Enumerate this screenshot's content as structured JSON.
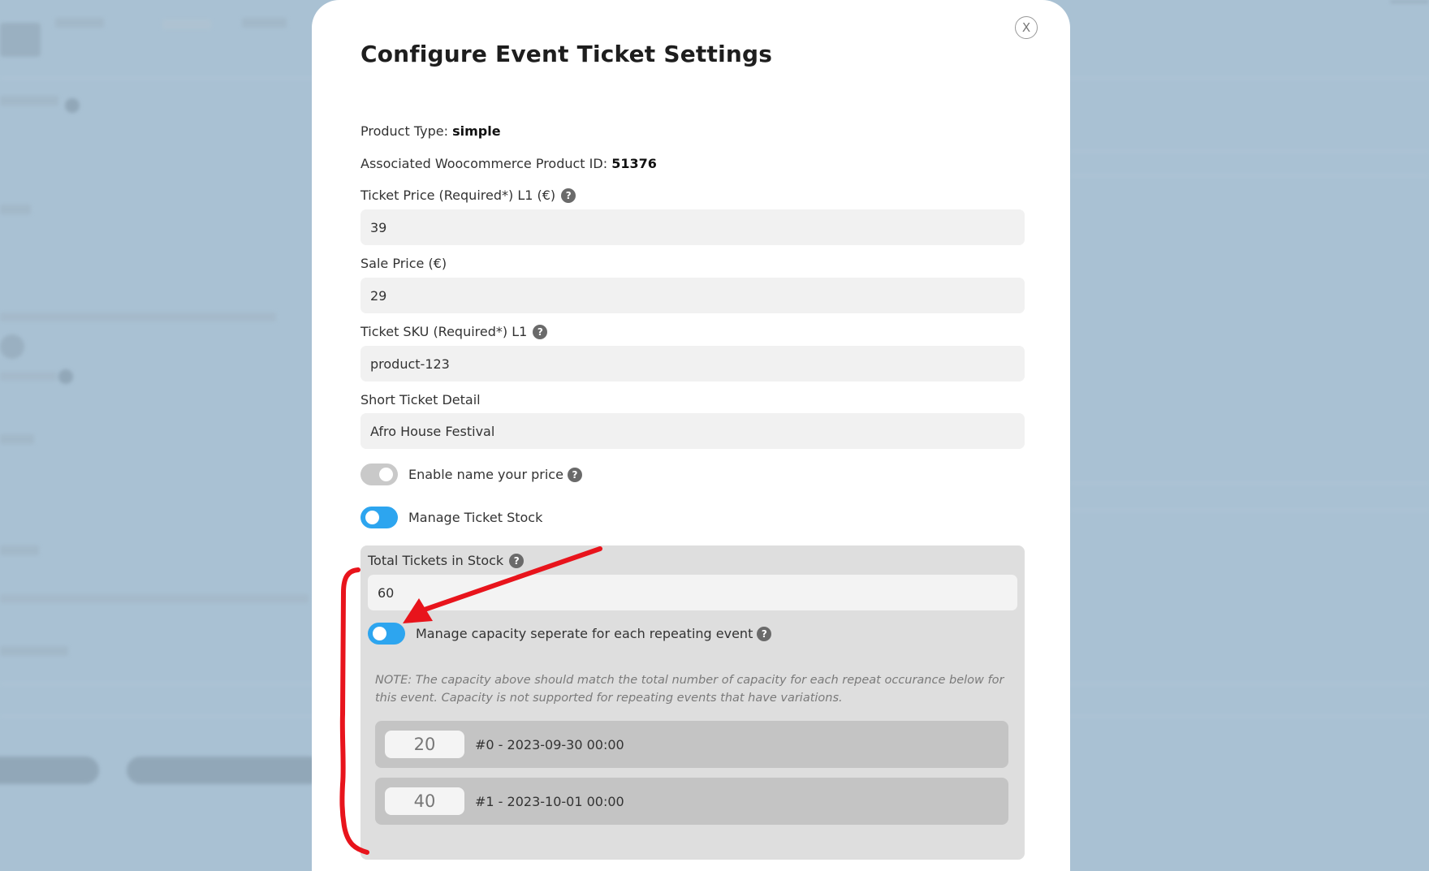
{
  "modal": {
    "title": "Configure Event Ticket Settings",
    "close_label": "X",
    "product_type": {
      "label": "Product Type:",
      "value": "simple"
    },
    "product_id": {
      "label": "Associated Woocommerce Product ID:",
      "value": "51376"
    },
    "ticket_price": {
      "label": "Ticket Price (Required*) L1 (€)",
      "value": "39"
    },
    "sale_price": {
      "label": "Sale Price (€)",
      "value": "29"
    },
    "ticket_sku": {
      "label": "Ticket SKU (Required*) L1",
      "value": "product-123"
    },
    "short_detail": {
      "label": "Short Ticket Detail",
      "value": "Afro House Festival"
    },
    "name_your_price": {
      "label": "Enable name your price",
      "state": "off"
    },
    "manage_stock": {
      "label": "Manage Ticket Stock",
      "state": "on"
    },
    "stock": {
      "total_label": "Total Tickets in Stock",
      "total_value": "60",
      "separate_capacity": {
        "label": "Manage capacity seperate for each repeating event",
        "state": "on"
      },
      "note": "NOTE: The capacity above should match the total number of capacity for each repeat occurance below for this event. Capacity is not supported for repeating events that have variations.",
      "occurrences": [
        {
          "capacity": "20",
          "label": "#0 - 2023-09-30 00:00"
        },
        {
          "capacity": "40",
          "label": "#1 - 2023-10-01 00:00"
        }
      ]
    }
  },
  "help_icon": "?",
  "colors": {
    "toggle_on": "#2da5ef",
    "toggle_off": "#c9c9c9",
    "annotation": "#e8141c",
    "backdrop": "#a9c1d3"
  },
  "icons": [
    "close-icon",
    "help-icon",
    "annotation-arrow",
    "annotation-bracket"
  ]
}
